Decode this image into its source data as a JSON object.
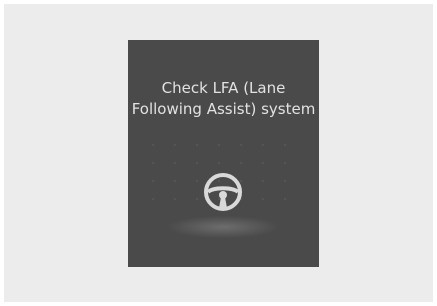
{
  "warning": {
    "line1": "Check LFA (Lane",
    "line2": "Following Assist) system"
  },
  "icons": {
    "status_icon": "steering-wheel-icon"
  },
  "colors": {
    "panel_bg": "#4a4a4a",
    "text": "#e2e2e2",
    "icon": "#d9d9d9",
    "frame_bg": "#ececec"
  }
}
